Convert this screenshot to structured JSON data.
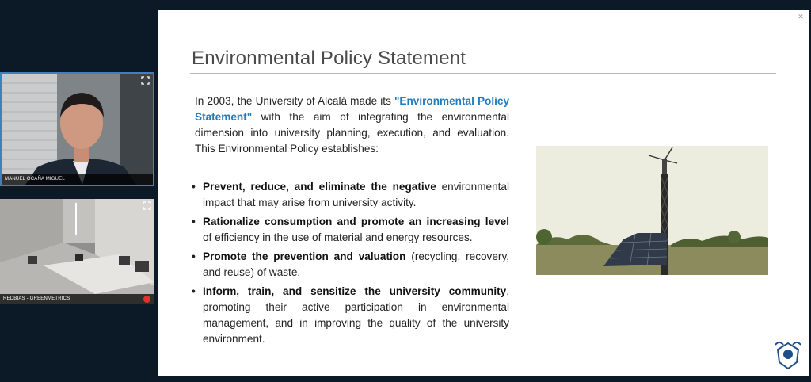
{
  "participants": [
    {
      "name": "MANUEL OCAÑA MIGUEL"
    },
    {
      "name": "REDBIAS - GREENMETRICS"
    }
  ],
  "slide": {
    "title": "Environmental Policy Statement",
    "intro_prefix": "In 2003, the University of Alcalá made its ",
    "intro_highlight": "\"Environmental Policy Statement\"",
    "intro_suffix": " with the aim of integrating the environmental dimension into university planning, execution, and evaluation. This Environmental Policy establishes:",
    "bullets": [
      {
        "bold": "Prevent, reduce, and eliminate the negative",
        "rest": " environmental impact that may arise from university activity."
      },
      {
        "bold": "Rationalize consumption and promote an increasing level",
        "rest": " of efficiency in the use of material and energy resources."
      },
      {
        "bold": "Promote the prevention and valuation",
        "rest": " (recycling, recovery, and reuse) of waste."
      },
      {
        "bold": "Inform, train, and sensitize the university community",
        "rest": ", promoting their active participation in environmental management, and in improving the quality of the university environment."
      }
    ]
  },
  "colors": {
    "highlight": "#1f7bc2",
    "active_border": "#3b82c4",
    "background": "#0c1a27"
  }
}
